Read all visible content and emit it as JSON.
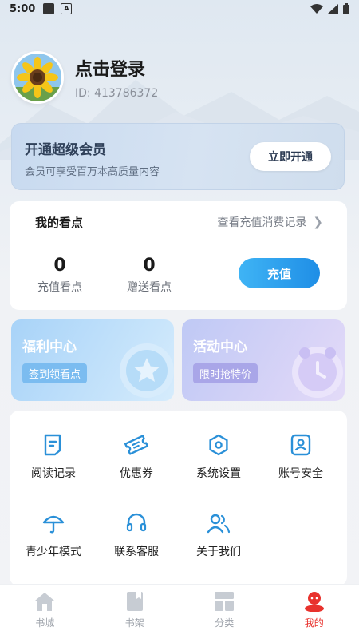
{
  "status_bar": {
    "time": "5:00",
    "notif_letter": "A"
  },
  "profile": {
    "title": "点击登录",
    "user_id": "ID: 413786372"
  },
  "vip": {
    "title": "开通超级会员",
    "subtitle": "会员可享受百万本高质量内容",
    "button": "立即开通"
  },
  "points": {
    "title": "我的看点",
    "link": "查看充值消费记录",
    "recharge_points": {
      "value": "0",
      "label": "充值看点"
    },
    "gift_points": {
      "value": "0",
      "label": "赠送看点"
    },
    "recharge_button": "充值"
  },
  "promos": {
    "welfare": {
      "title": "福利中心",
      "tag": "签到领看点"
    },
    "activity": {
      "title": "活动中心",
      "tag": "限时抢特价"
    }
  },
  "menu": {
    "reading_history": "阅读记录",
    "coupons": "优惠券",
    "settings": "系统设置",
    "account_security": "账号安全",
    "teen_mode": "青少年模式",
    "customer_service": "联系客服",
    "about_us": "关于我们"
  },
  "nav": {
    "bookstore": "书城",
    "bookshelf": "书架",
    "category": "分类",
    "mine": "我的"
  },
  "colors": {
    "accent_blue": "#1f8ee6",
    "icon_blue": "#2a90d8",
    "active_red": "#e8322d"
  }
}
